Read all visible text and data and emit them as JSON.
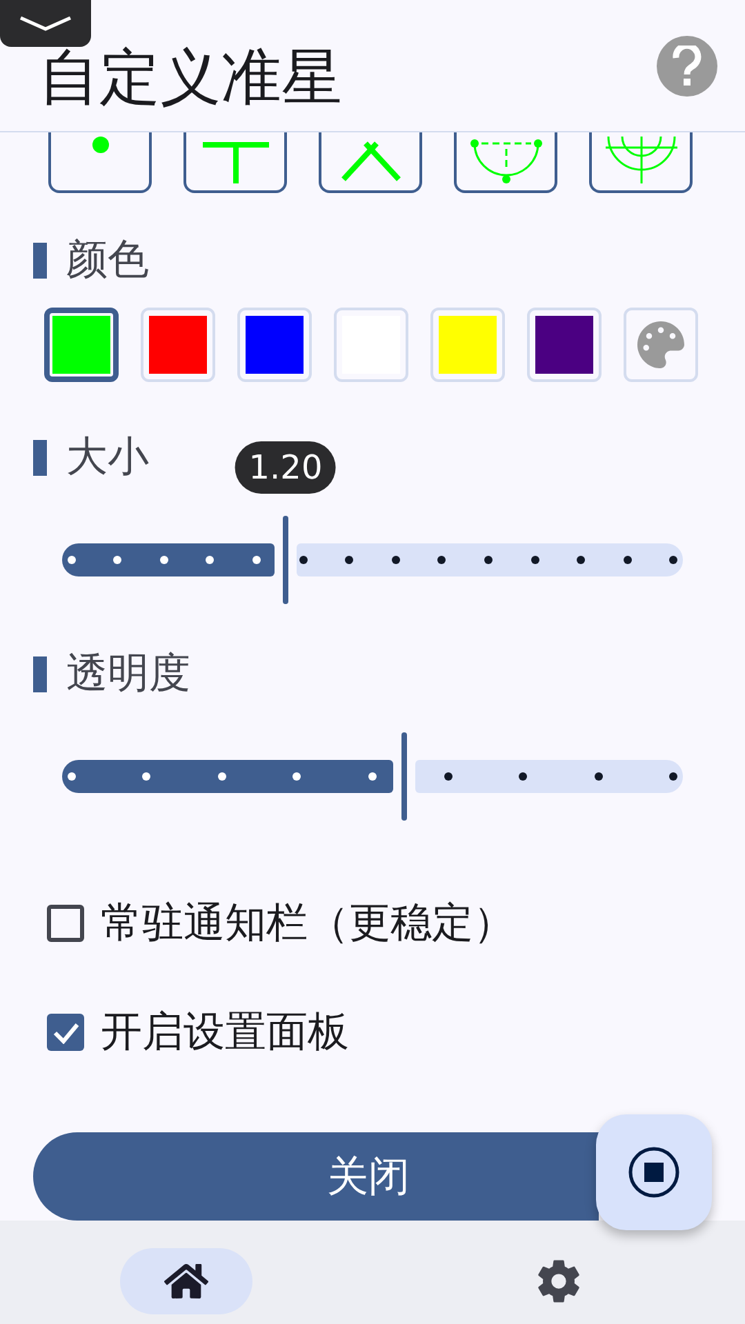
{
  "title": "自定义准星",
  "crosshairs": [
    {
      "kind": "dot"
    },
    {
      "kind": "cross"
    },
    {
      "kind": "x"
    },
    {
      "kind": "arc"
    },
    {
      "kind": "scope"
    }
  ],
  "color_section": {
    "label": "颜色"
  },
  "colors": [
    {
      "color": "#00ff00",
      "selected": true,
      "kind": "swatch"
    },
    {
      "color": "#ff0000",
      "selected": false,
      "kind": "swatch"
    },
    {
      "color": "#0000ff",
      "selected": false,
      "kind": "swatch"
    },
    {
      "color": "#ffffff",
      "selected": false,
      "kind": "swatch"
    },
    {
      "color": "#ffff00",
      "selected": false,
      "kind": "swatch"
    },
    {
      "color": "#4b0082",
      "selected": false,
      "kind": "swatch"
    },
    {
      "kind": "palette",
      "selected": false
    }
  ],
  "sliders": [
    {
      "label": "大小",
      "level": 0.36,
      "kind": "fine",
      "tooltip": "1.20"
    },
    {
      "label": "透明度",
      "level": 0.55,
      "kind": "coarse"
    }
  ],
  "checkboxes": [
    {
      "label": "常驻通知栏（更稳定）",
      "checked": false
    },
    {
      "label": "开启设置面板",
      "checked": true
    }
  ],
  "close_button": {
    "label": "关闭"
  },
  "nav": [
    {
      "kind": "home",
      "selected": true
    },
    {
      "kind": "settings",
      "selected": false
    }
  ]
}
